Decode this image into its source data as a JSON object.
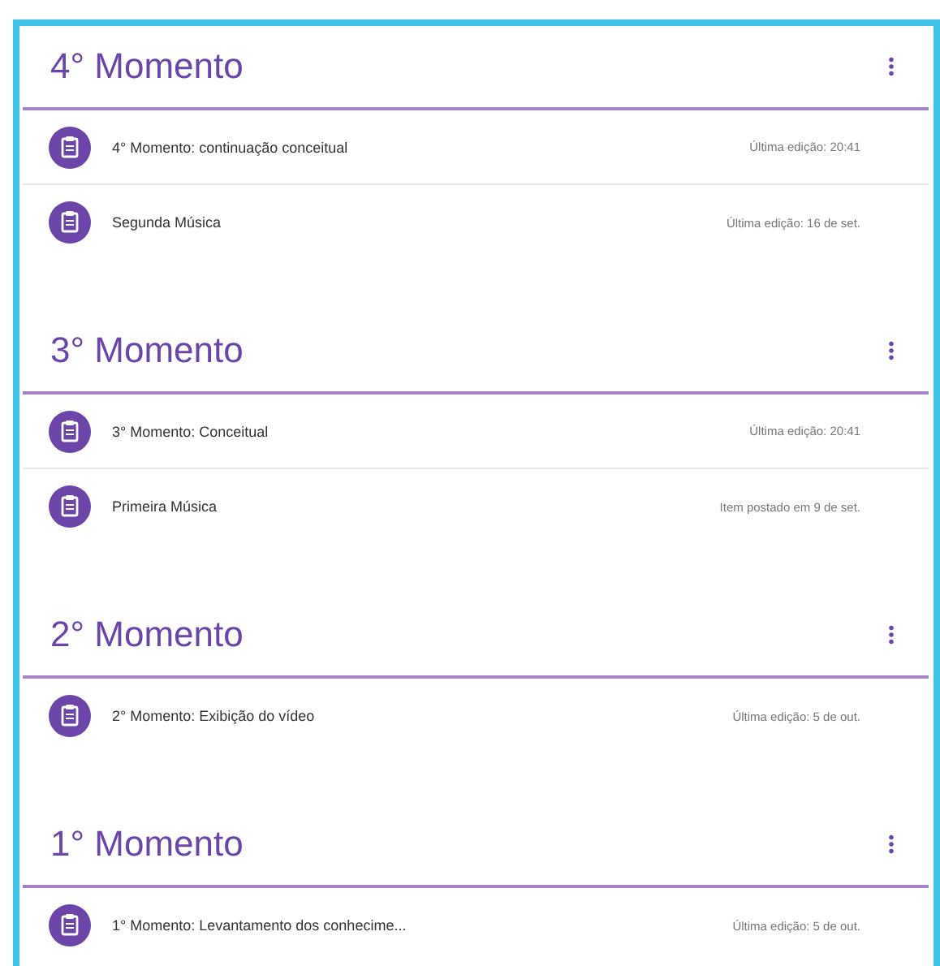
{
  "sections": [
    {
      "title": "4° Momento",
      "items": [
        {
          "title": "4° Momento: continuação conceitual",
          "meta": "Última edição: 20:41"
        },
        {
          "title": "Segunda Música",
          "meta": "Última edição: 16 de set."
        }
      ]
    },
    {
      "title": "3° Momento",
      "items": [
        {
          "title": "3° Momento: Conceitual",
          "meta": "Última edição: 20:41"
        },
        {
          "title": "Primeira Música",
          "meta": "Item postado em 9 de set."
        }
      ]
    },
    {
      "title": "2° Momento",
      "items": [
        {
          "title": "2° Momento: Exibição do vídeo",
          "meta": "Última edição: 5 de out."
        }
      ]
    },
    {
      "title": "1° Momento",
      "items": [
        {
          "title": "1° Momento: Levantamento dos conhecime...",
          "meta": "Última edição: 5 de out."
        }
      ]
    }
  ]
}
